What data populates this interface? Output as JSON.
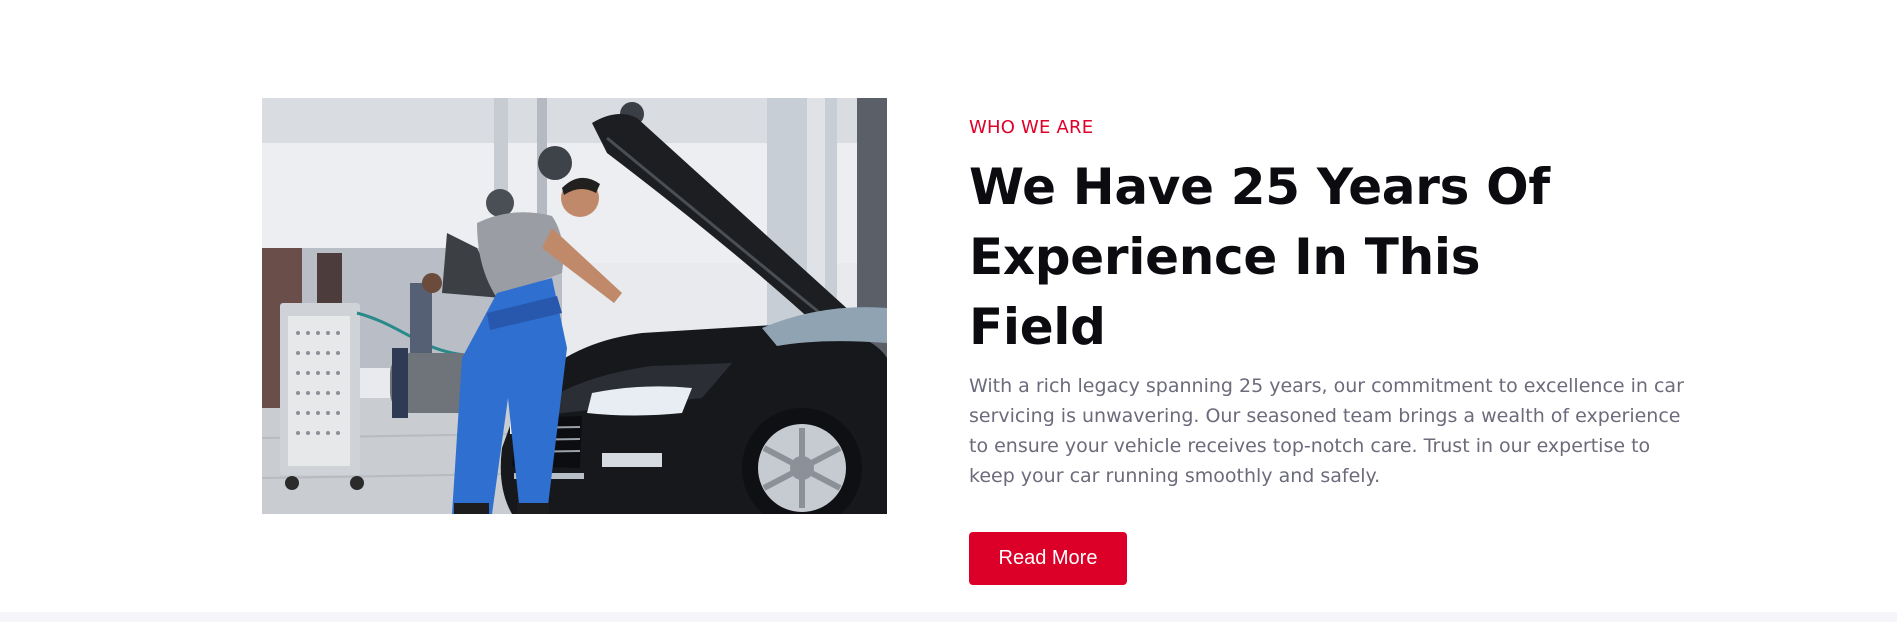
{
  "about": {
    "eyebrow": "WHO WE ARE",
    "heading": "We Have 25 Years Of Experience In This Field",
    "description": "With a rich legacy spanning 25 years, our commitment to excellence in car servicing is unwavering. Our seasoned team brings a wealth of experience to ensure your vehicle receives top-notch care. Trust in our expertise to keep your car running smoothly and safely.",
    "button_label": "Read More"
  },
  "colors": {
    "accent": "#dc0029",
    "eyebrow": "#e0002a",
    "heading": "#0b0b10",
    "body_text": "#6b6b7b",
    "bottom_band": "#f6f6fa"
  },
  "image": {
    "subject": "mechanic-servicing-car-photo"
  }
}
